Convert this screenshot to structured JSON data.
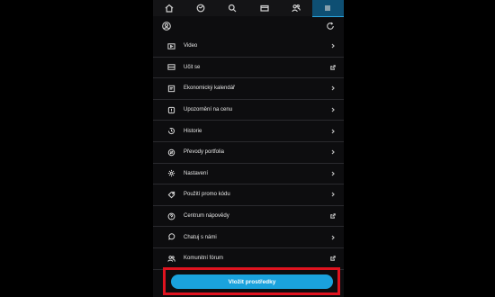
{
  "top_nav": [
    {
      "icon": "home-icon"
    },
    {
      "icon": "portfolio-icon"
    },
    {
      "icon": "search-icon"
    },
    {
      "icon": "wallet-icon"
    },
    {
      "icon": "community-icon"
    },
    {
      "icon": "menu-icon",
      "active": true
    }
  ],
  "menu": {
    "items": [
      {
        "label": "Video",
        "icon": "video-icon",
        "trail": "chevron"
      },
      {
        "label": "Učit se",
        "icon": "learn-icon",
        "trail": "external"
      },
      {
        "label": "Ekonomický kalendář",
        "icon": "calendar-icon",
        "trail": "chevron"
      },
      {
        "label": "Upozornění na cenu",
        "icon": "price-alert-icon",
        "trail": "chevron"
      },
      {
        "label": "Historie",
        "icon": "history-icon",
        "trail": "chevron"
      },
      {
        "label": "Převody portfolia",
        "icon": "transfer-icon",
        "trail": "chevron"
      },
      {
        "label": "Nastavení",
        "icon": "settings-icon",
        "trail": "chevron"
      },
      {
        "label": "Použití promo kódu",
        "icon": "promo-icon",
        "trail": "chevron"
      },
      {
        "label": "Centrum nápovědy",
        "icon": "help-icon",
        "trail": "external"
      },
      {
        "label": "Chatuj s námi",
        "icon": "chat-icon",
        "trail": "chevron"
      },
      {
        "label": "Komunitní fórum",
        "icon": "forum-icon",
        "trail": "external"
      }
    ]
  },
  "cta": {
    "label": "Vložit prostředky"
  },
  "colors": {
    "accent": "#1aa2dd",
    "highlight": "#e0131f",
    "active_tab": "#0e4f73"
  }
}
